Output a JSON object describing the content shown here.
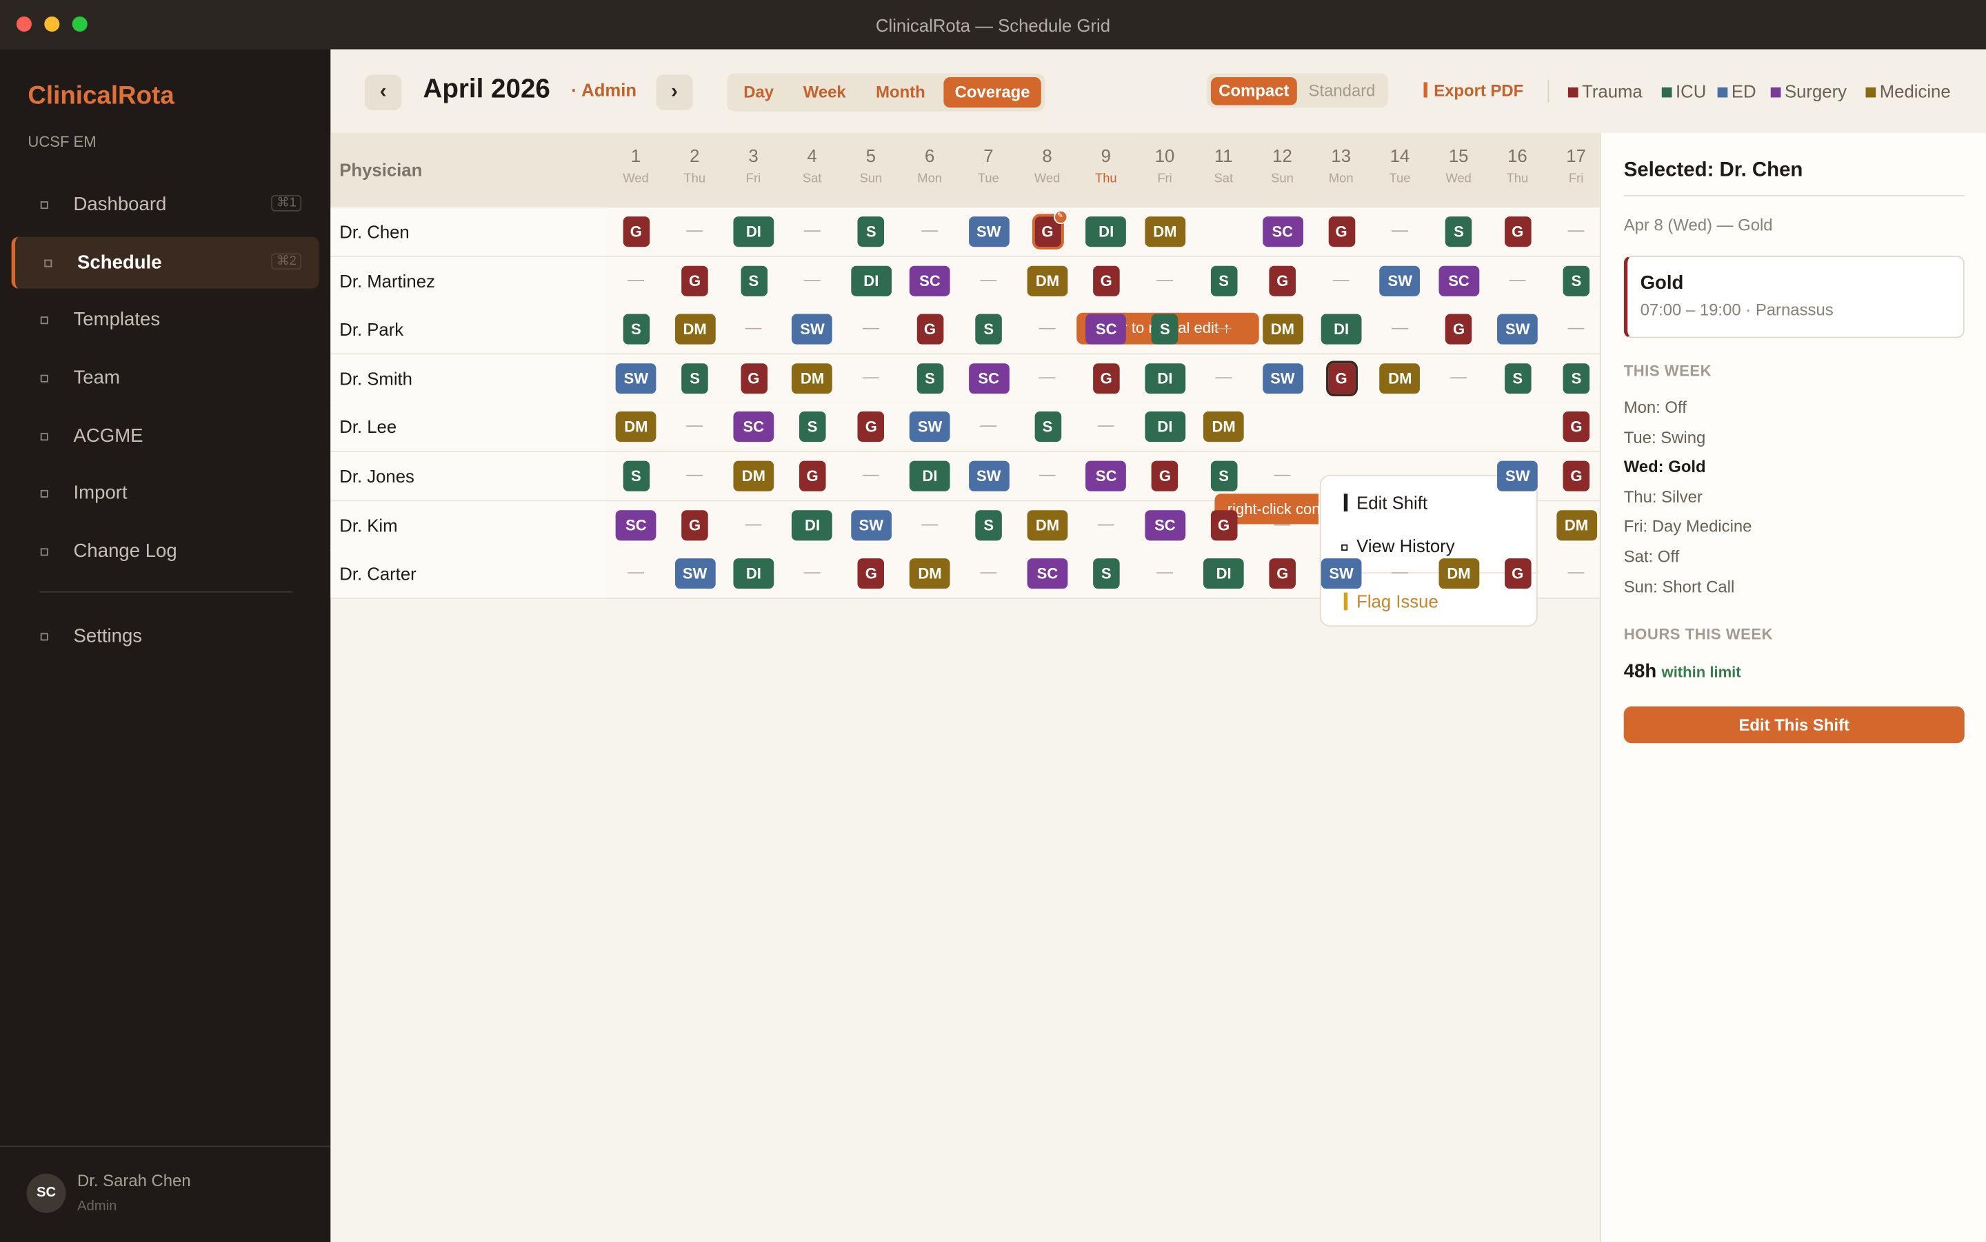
{
  "window": {
    "title": "ClinicalRota — Schedule Grid"
  },
  "sidebar": {
    "brand": "ClinicalRota",
    "org": "UCSF EM",
    "items": [
      {
        "label": "Dashboard",
        "shortcut": "⌘1",
        "active": false
      },
      {
        "label": "Schedule",
        "shortcut": "⌘2",
        "active": true
      },
      {
        "label": "Templates",
        "shortcut": "",
        "active": false
      },
      {
        "label": "Team",
        "shortcut": "",
        "active": false
      },
      {
        "label": "ACGME",
        "shortcut": "",
        "active": false
      },
      {
        "label": "Import",
        "shortcut": "",
        "active": false
      },
      {
        "label": "Change Log",
        "shortcut": "",
        "active": false
      },
      {
        "label": "Settings",
        "shortcut": "",
        "active": false
      }
    ],
    "user": {
      "initials": "SC",
      "name": "Dr. Sarah Chen",
      "role": "Admin"
    }
  },
  "header": {
    "prev": "‹",
    "next": "›",
    "month": "April 2026",
    "role": "· Admin",
    "views": [
      {
        "label": "Day",
        "active": false
      },
      {
        "label": "Week",
        "active": false
      },
      {
        "label": "Month",
        "active": false
      },
      {
        "label": "Coverage",
        "active": true
      }
    ],
    "density": [
      {
        "label": "Compact",
        "active": true
      },
      {
        "label": "Standard",
        "active": false
      }
    ],
    "export": "Export PDF",
    "legend": [
      {
        "label": "Trauma",
        "color": "#8c2a2a"
      },
      {
        "label": "ICU",
        "color": "#2e6b4f"
      },
      {
        "label": "ED",
        "color": "#4a6fa5"
      },
      {
        "label": "Surgery",
        "color": "#7a3a9a"
      },
      {
        "label": "Medicine",
        "color": "#8b6914"
      }
    ]
  },
  "grid": {
    "physician_header": "Physician",
    "days": [
      {
        "n": "1",
        "w": "Wed"
      },
      {
        "n": "2",
        "w": "Thu"
      },
      {
        "n": "3",
        "w": "Fri"
      },
      {
        "n": "4",
        "w": "Sat"
      },
      {
        "n": "5",
        "w": "Sun"
      },
      {
        "n": "6",
        "w": "Mon"
      },
      {
        "n": "7",
        "w": "Tue"
      },
      {
        "n": "8",
        "w": "Wed"
      },
      {
        "n": "9",
        "w": "Thu",
        "today": true
      },
      {
        "n": "10",
        "w": "Fri"
      },
      {
        "n": "11",
        "w": "Sat"
      },
      {
        "n": "12",
        "w": "Sun"
      },
      {
        "n": "13",
        "w": "Mon"
      },
      {
        "n": "14",
        "w": "Tue"
      },
      {
        "n": "15",
        "w": "Wed"
      },
      {
        "n": "16",
        "w": "Thu"
      },
      {
        "n": "17",
        "w": "Fri"
      }
    ],
    "rows": [
      {
        "name": "Dr. Chen",
        "cells": [
          "G",
          "—",
          "DI",
          "—",
          "S",
          "—",
          "SW",
          "G",
          "DI",
          "DM",
          "",
          "SC",
          "G",
          "—",
          "S",
          "G",
          "—"
        ]
      },
      {
        "name": "Dr. Martinez",
        "cells": [
          "—",
          "G",
          "S",
          "—",
          "DI",
          "SC",
          "—",
          "DM",
          "G",
          "—",
          "S",
          "G",
          "—",
          "SW",
          "SC",
          "—",
          "S"
        ]
      },
      {
        "name": "Dr. Park",
        "cells": [
          "S",
          "DM",
          "—",
          "SW",
          "—",
          "G",
          "S",
          "—",
          "SC",
          "S",
          "—",
          "DM",
          "DI",
          "—",
          "G",
          "SW",
          "—"
        ]
      },
      {
        "name": "Dr. Smith",
        "cells": [
          "SW",
          "S",
          "G",
          "DM",
          "—",
          "S",
          "SC",
          "—",
          "G",
          "DI",
          "—",
          "SW",
          "G",
          "DM",
          "—",
          "S",
          "S"
        ]
      },
      {
        "name": "Dr. Lee",
        "cells": [
          "DM",
          "—",
          "SC",
          "S",
          "G",
          "SW",
          "—",
          "S",
          "—",
          "DI",
          "DM",
          "",
          "",
          "",
          "",
          "",
          "G"
        ]
      },
      {
        "name": "Dr. Jones",
        "cells": [
          "S",
          "—",
          "DM",
          "G",
          "—",
          "DI",
          "SW",
          "—",
          "SC",
          "G",
          "S",
          "—",
          "",
          "",
          "",
          "SW",
          "G"
        ]
      },
      {
        "name": "Dr. Kim",
        "cells": [
          "SC",
          "G",
          "—",
          "DI",
          "SW",
          "—",
          "S",
          "DM",
          "—",
          "SC",
          "G",
          "—",
          "",
          "",
          "",
          "",
          "DM"
        ]
      },
      {
        "name": "Dr. Carter",
        "cells": [
          "—",
          "SW",
          "DI",
          "—",
          "G",
          "DM",
          "—",
          "SC",
          "S",
          "—",
          "DI",
          "G",
          "SW",
          "—",
          "DM",
          "G",
          "—"
        ]
      }
    ],
    "hover_tip": "hover to reveal edit ↑",
    "right_click_tip": "right-click context menu"
  },
  "context_menu": {
    "items": [
      "Edit Shift",
      "View History",
      "Flag Issue"
    ]
  },
  "panel": {
    "title": "Selected: Dr. Chen",
    "subtitle": "Apr 8 (Wed) — Gold",
    "shift_name": "Gold",
    "shift_detail": "07:00 – 19:00 · Parnassus",
    "week_title": "THIS WEEK",
    "week": [
      {
        "text": "Mon: Off",
        "bold": false
      },
      {
        "text": "Tue: Swing",
        "bold": false
      },
      {
        "text": "Wed: Gold",
        "bold": true
      },
      {
        "text": "Thu: Silver",
        "bold": false
      },
      {
        "text": "Fri: Day Medicine",
        "bold": false
      },
      {
        "text": "Sat: Off",
        "bold": false
      },
      {
        "text": "Sun: Short Call",
        "bold": false
      }
    ],
    "hours_title": "HOURS THIS WEEK",
    "hours": "48h",
    "hours_note": "within limit",
    "edit_button": "Edit This Shift"
  },
  "shift_colors": {
    "G": "#8c2a2a",
    "S": "#2e6b4f",
    "DI": "#2e6b4f",
    "SW": "#4a6fa5",
    "SC": "#7a3a9a",
    "DM": "#8b6914"
  }
}
